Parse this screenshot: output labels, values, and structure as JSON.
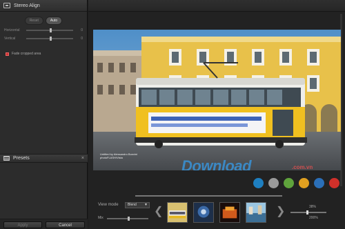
{
  "panel": {
    "title": "Stereo Align",
    "modes": [
      {
        "label": "Reset"
      },
      {
        "label": "Auto"
      }
    ],
    "sliders": [
      {
        "label": "Horizontal",
        "value": "0"
      },
      {
        "label": "Vertical",
        "value": "0"
      }
    ],
    "checkbox_label": "Fade cropped area",
    "checkbox_checked": true
  },
  "presets": {
    "title": "Presets"
  },
  "buttons": {
    "apply": "Apply",
    "cancel": "Cancel"
  },
  "photo": {
    "caption_line1": "Untitled by Alessandro Bonvini",
    "caption_line2": "photoFLASH/Vista"
  },
  "watermark": {
    "brand": "Download",
    "suffix": ".com.vn"
  },
  "color_swatches": [
    "#1e7fc0",
    "#9a9a9a",
    "#5fa33c",
    "#e0a020",
    "#2b6fb8",
    "#d0302a"
  ],
  "view": {
    "mode_label": "View mode",
    "mode_value": "Blend",
    "mix_label": "Mix",
    "mix_level": 0.5
  },
  "zoom": {
    "percent": "38%",
    "max": "200%",
    "level": 0.45
  },
  "icons": {
    "left_arrow": "chevron-left-icon",
    "right_arrow": "chevron-right-icon"
  }
}
